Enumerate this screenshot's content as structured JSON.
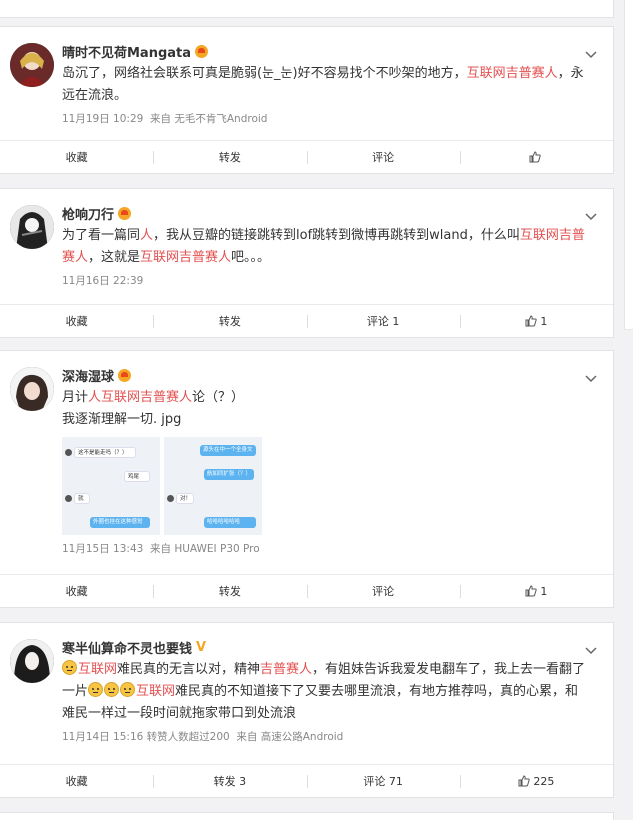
{
  "posts": [
    {
      "username": "晴时不见荷Mangata",
      "text_segments": [
        {
          "t": "岛沉了，网络社会联系可真是脆弱(눈_눈)好不容易找个不吵架的地方，",
          "hl": false
        },
        {
          "t": "互联网吉普赛人",
          "hl": true
        },
        {
          "t": "，永远在流浪。",
          "hl": false
        }
      ],
      "time": "11月19日 10:29",
      "source": "来自 无毛不肯飞Android",
      "actions": {
        "collect": "收藏",
        "repost": "转发",
        "comment": "评论",
        "like": ""
      }
    },
    {
      "username": "枪响刀行",
      "text_segments": [
        {
          "t": "为了看一篇同",
          "hl": false
        },
        {
          "t": "人",
          "hl": true
        },
        {
          "t": "，我从豆瓣的链接跳转到lof跳转到微博再跳转到wland，什么叫",
          "hl": false
        },
        {
          "t": "互联网吉普赛人",
          "hl": true
        },
        {
          "t": "，这就是",
          "hl": false
        },
        {
          "t": "互联网吉普赛人",
          "hl": true
        },
        {
          "t": "吧。。。",
          "hl": false
        }
      ],
      "time": "11月16日 22:39",
      "source": "",
      "actions": {
        "collect": "收藏",
        "repost": "转发",
        "comment": "评论 1",
        "like": "1"
      }
    },
    {
      "username": "深海湿球",
      "text_segments": [
        {
          "t": "月计",
          "hl": false
        },
        {
          "t": "人互联网吉普赛人",
          "hl": true
        },
        {
          "t": "论（？）",
          "hl": false
        }
      ],
      "text_line2": "我逐渐理解一切. jpg",
      "images": [
        {
          "bubbles": [
            {
              "text": "这不是能走吗（？）",
              "style": "white"
            },
            {
              "text": "鸡尾",
              "style": "white"
            },
            {
              "text": "就",
              "style": "white"
            },
            {
              "text": "外圈也挂在这种感觉",
              "style": "blue"
            }
          ]
        },
        {
          "bubbles": [
            {
              "text": "源头在中一个全身文",
              "style": "blue"
            },
            {
              "text": "航如同扩张（？）",
              "style": "blue"
            },
            {
              "text": "对！",
              "style": "white"
            },
            {
              "text": "哈哈哈哈哈哈",
              "style": "blue"
            }
          ]
        }
      ],
      "time": "11月15日 13:43",
      "source": "来自 HUAWEI P30 Pro",
      "actions": {
        "collect": "收藏",
        "repost": "转发",
        "comment": "评论",
        "like": "1"
      }
    },
    {
      "username": "寒半仙算命不灵也要钱",
      "verified_mark": "V",
      "text_segments": [
        {
          "t": "",
          "emoji": true
        },
        {
          "t": "互联网",
          "hl": true
        },
        {
          "t": "难民真的无言以对，精神",
          "hl": false
        },
        {
          "t": "吉普赛人",
          "hl": true
        },
        {
          "t": "，有姐妹告诉我爱发电翻车了，我上去一看翻了一片",
          "hl": false
        },
        {
          "t": "",
          "emoji": true
        },
        {
          "t": "",
          "emoji": true
        },
        {
          "t": "",
          "emoji": true
        },
        {
          "t": "互联网",
          "hl": true
        },
        {
          "t": "难民真的不知道接下了又要去哪里流浪，有地方推荐吗，真的心累，和难民一样过一段时间就拖家带口到处流浪",
          "hl": false
        }
      ],
      "time": "11月14日 15:16",
      "extra": "转赞人数超过200",
      "source": "来自 高速公路Android",
      "actions": {
        "collect": "收藏",
        "repost": "转发 3",
        "comment": "评论 71",
        "like": "225"
      }
    }
  ]
}
